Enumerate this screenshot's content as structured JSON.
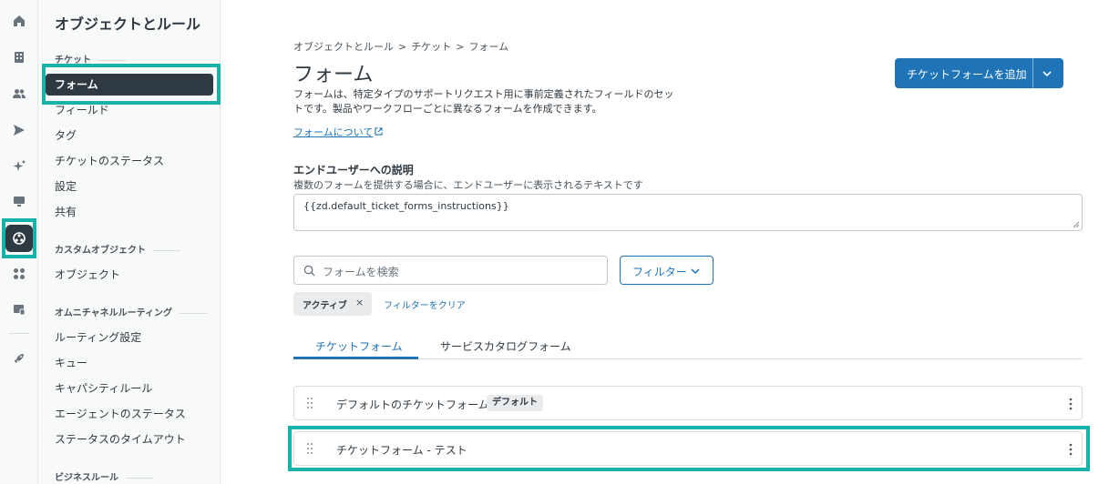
{
  "rail": {
    "items": [
      "home-icon",
      "building-icon",
      "users-icon",
      "send-icon",
      "sparkle-icon",
      "monitor-icon",
      "objects-rules-icon",
      "apps-icon",
      "workspace-icon",
      "rocket-icon"
    ]
  },
  "nav": {
    "title": "オブジェクトとルール",
    "sections": {
      "tickets": "チケット",
      "custom_objects": "カスタムオブジェクト",
      "omnichannel": "オムニチャネルルーティング",
      "business_rules": "ビジネスルール"
    },
    "items": {
      "forms": "フォーム",
      "fields": "フィールド",
      "tags": "タグ",
      "ticket_status": "チケットのステータス",
      "settings": "設定",
      "sharing": "共有",
      "objects": "オブジェクト",
      "routing_settings": "ルーティング設定",
      "queues": "キュー",
      "capacity_rules": "キャパシティルール",
      "agent_status": "エージェントのステータス",
      "status_timeout": "ステータスのタイムアウト"
    }
  },
  "breadcrumb": {
    "level1": "オブジェクトとルール",
    "level2": "チケット",
    "level3": "フォーム",
    "separator": ">"
  },
  "page": {
    "title": "フォーム",
    "description": "フォームは、特定タイプのサポートリクエスト用に事前定義されたフィールドのセットです。製品やワークフローごとに異なるフォームを作成できます。",
    "about_link": "フォームについて",
    "add_button": "チケットフォームを追加"
  },
  "end_user": {
    "label": "エンドユーザーへの説明",
    "hint": "複数のフォームを提供する場合に、エンドユーザーに表示されるテキストです",
    "value": "{{zd.default_ticket_forms_instructions}}"
  },
  "search": {
    "placeholder": "フォームを検索"
  },
  "filter": {
    "button": "フィルター"
  },
  "chip": {
    "label": "アクティブ",
    "remove": "×"
  },
  "clear_filters": "フィルターをクリア",
  "tabs": {
    "ticket_forms": "チケットフォーム",
    "service_catalog": "サービスカタログフォーム"
  },
  "forms": [
    {
      "name": "デフォルトのチケットフォーム",
      "badge": "デフォルト"
    },
    {
      "name": "チケットフォーム - テスト"
    }
  ],
  "colors": {
    "accent": "#1f73b7",
    "highlight": "#17b3a8",
    "nav_active": "#2f3941"
  }
}
